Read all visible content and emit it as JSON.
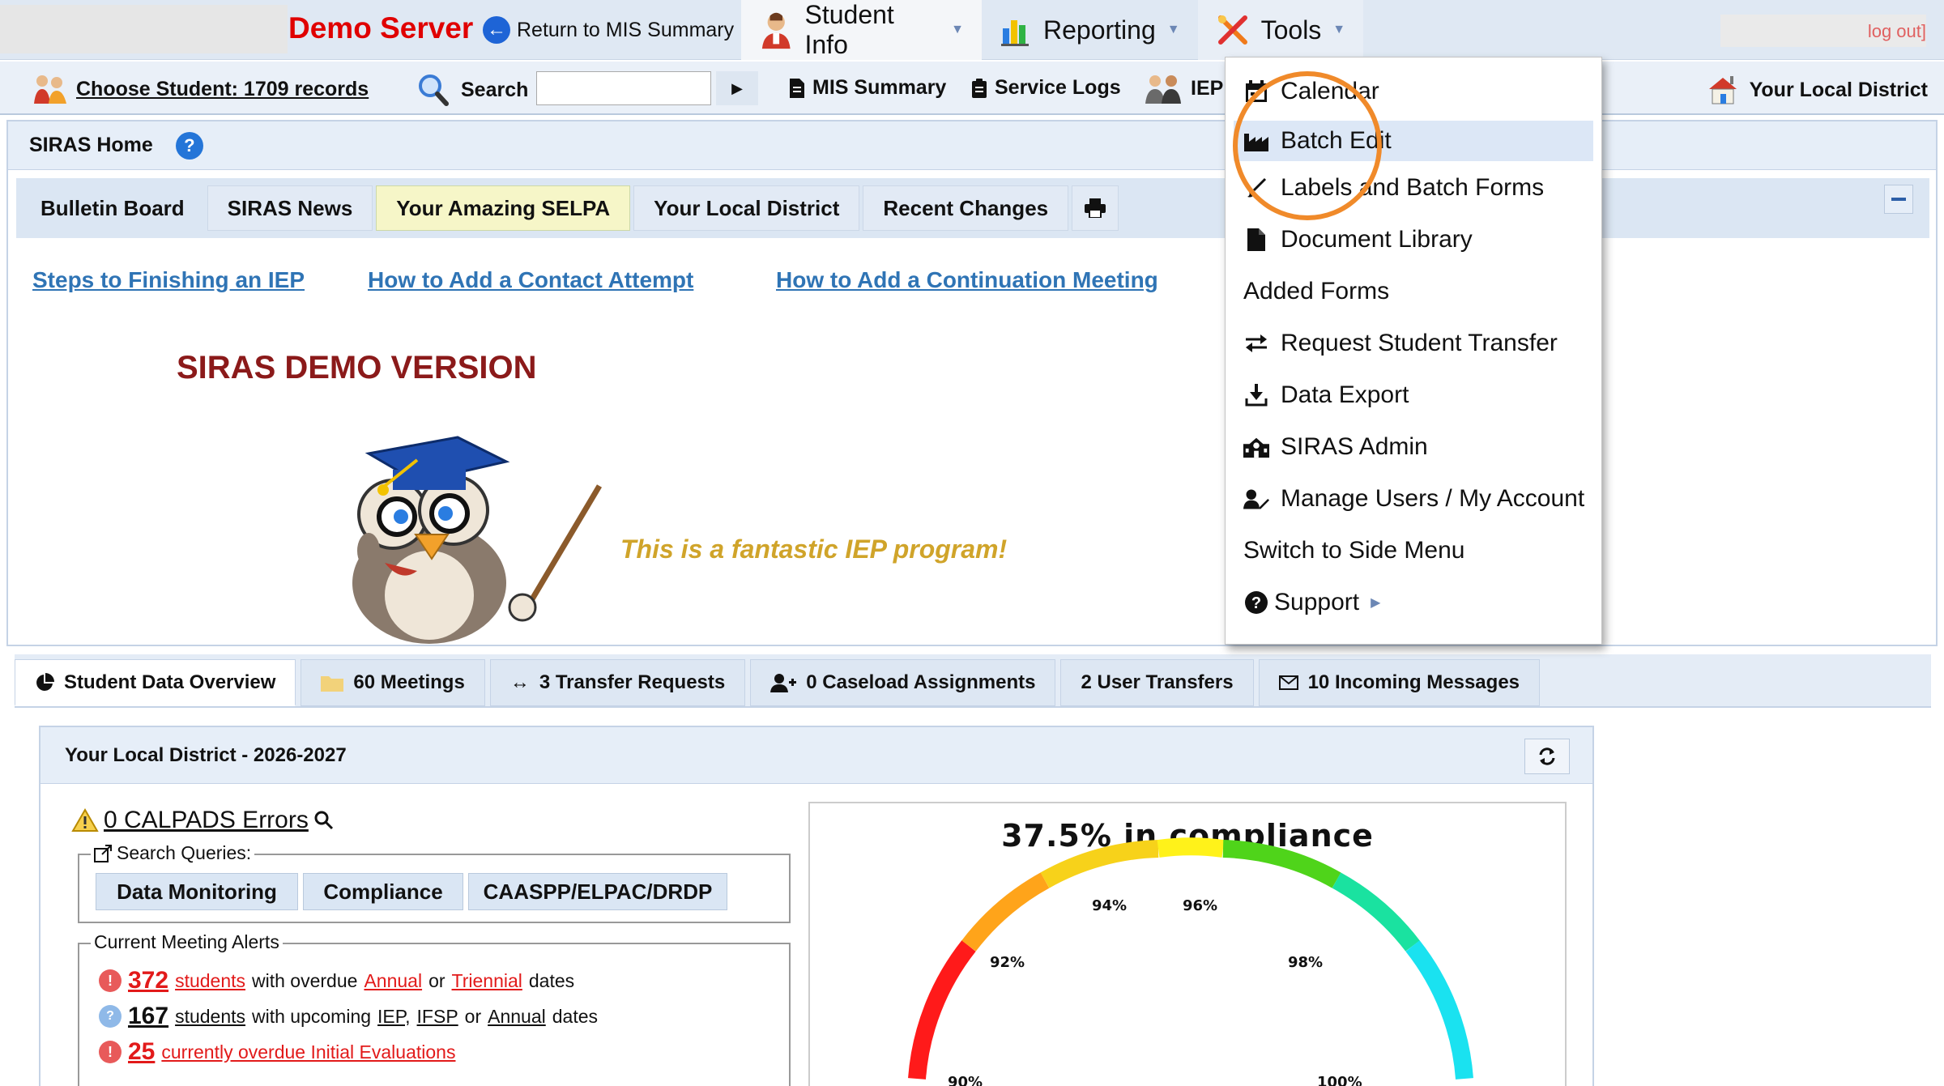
{
  "topbar": {
    "server_name": "Demo Server",
    "return_label": "Return to MIS Summary",
    "nav": {
      "student_info": "Student Info",
      "reporting": "Reporting",
      "tools": "Tools"
    },
    "logout": "log out]"
  },
  "secondbar": {
    "choose_student": "Choose Student: 1709 records",
    "search_label": "Search",
    "search_value": "",
    "mis_summary": "MIS Summary",
    "service_logs": "Service Logs",
    "iep": "IEP",
    "your_local_district": "Your Local District"
  },
  "home": {
    "title": "SIRAS Home",
    "tabs": [
      "Bulletin Board",
      "SIRAS News",
      "Your Amazing SELPA",
      "Your Local District",
      "Recent Changes"
    ],
    "links": [
      "Steps to Finishing an IEP",
      "How to Add a Contact Attempt",
      "How to Add a Continuation Meeting"
    ],
    "demo_version": "SIRAS DEMO VERSION",
    "tagline": "This is a fantastic IEP program!"
  },
  "overview": {
    "tabs": [
      "Student Data Overview",
      "60 Meetings",
      "3 Transfer Requests",
      "0 Caseload Assignments",
      "2 User Transfers",
      "10 Incoming Messages"
    ],
    "district_title": "Your Local District - 2026-2027",
    "calpads": "0 CALPADS Errors",
    "search_queries_label": "Search Queries:",
    "query_buttons": [
      "Data Monitoring",
      "Compliance",
      "CAASPP/ELPAC/DRDP"
    ],
    "alerts_label": "Current Meeting Alerts",
    "alert1": {
      "count": "372",
      "students": "students",
      "text1": "with overdue",
      "annual": "Annual",
      "or": "or",
      "triennial": "Triennial",
      "text2": "dates"
    },
    "alert2": {
      "count": "167",
      "students": "students",
      "text1": "with upcoming",
      "iep": "IEP,",
      "ifsp": "IFSP",
      "or": "or",
      "annual": "Annual",
      "text2": "dates"
    },
    "alert3": {
      "count": "25",
      "text": "currently overdue Initial Evaluations"
    }
  },
  "gauge": {
    "title": "37.5% in compliance",
    "tick_labels": [
      "90%",
      "92%",
      "94%",
      "96%",
      "98%",
      "100%"
    ]
  },
  "tools_menu": {
    "items": [
      "Calendar",
      "Batch Edit",
      "Labels and Batch Forms",
      "Document Library",
      "Added Forms",
      "Request Student Transfer",
      "Data Export",
      "SIRAS Admin",
      "Manage Users / My Account",
      "Switch to Side Menu",
      "Support"
    ],
    "highlighted": "Batch Edit"
  },
  "colors": {
    "accent_blue": "#2f74b5",
    "server_red": "#e00000",
    "highlight_orange": "#f08a2a",
    "tagline_gold": "#d0a42a"
  }
}
